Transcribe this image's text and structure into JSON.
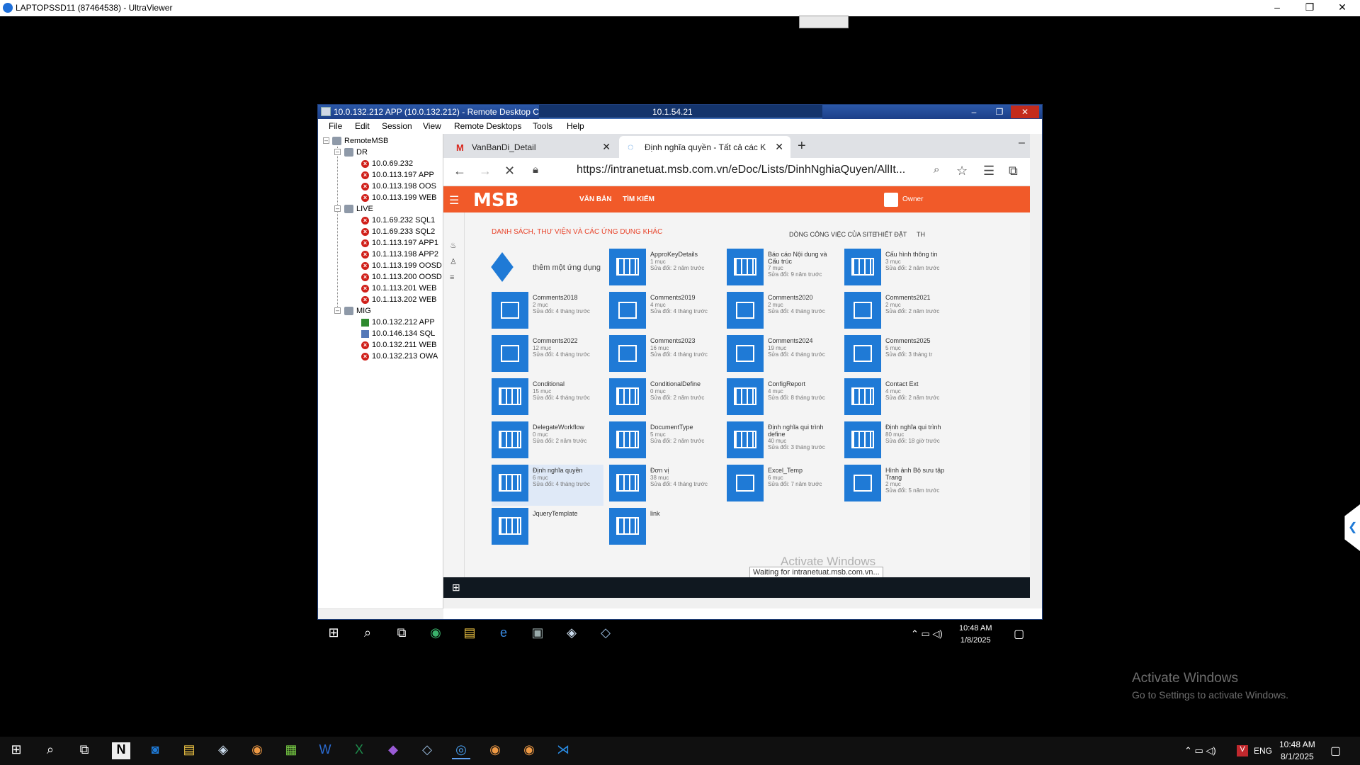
{
  "uv": {
    "title": "LAPTOPSSD11 (87464538) - UltraViewer",
    "minimize": "–",
    "restore": "❐",
    "close": "✕"
  },
  "rdc": {
    "title": "10.0.132.212 APP (10.0.132.212) - Remote Desktop C",
    "conn_ip": "10.1.54.21",
    "menu": [
      "File",
      "Edit",
      "Session",
      "View",
      "Remote Desktops",
      "Tools",
      "Help"
    ],
    "tree": {
      "root": "RemoteMSB",
      "groups": [
        {
          "name": "DR",
          "items": [
            "10.0.69.232",
            "10.0.113.197 APP",
            "10.0.113.198 OOS",
            "10.0.113.199 WEB"
          ]
        },
        {
          "name": "LIVE",
          "items": [
            "10.1.69.232 SQL1",
            "10.1.69.233 SQL2",
            "10.1.113.197 APP1",
            "10.1.113.198 APP2",
            "10.1.113.199 OOSD",
            "10.1.113.200 OOSD",
            "10.1.113.201 WEB",
            "10.1.113.202 WEB"
          ]
        },
        {
          "name": "MIG",
          "items": [
            "10.0.132.212 APP",
            "10.0.146.134 SQL",
            "10.0.132.211 WEB",
            "10.0.132.213 OWA"
          ]
        }
      ]
    }
  },
  "browser": {
    "tabs": [
      {
        "label": "VanBanDi_Detail"
      },
      {
        "label": "Định nghĩa quyền - Tất cả các K"
      }
    ],
    "url": "https://intranetuat.msb.com.vn/eDoc/Lists/DinhNghiaQuyen/AllIt...",
    "status": "Waiting for intranetuat.msb.com.vn..."
  },
  "msb": {
    "logo": "MSB",
    "nav": [
      "VĂN BẢN",
      "TÌM KIẾM"
    ],
    "owner": "Owner",
    "section_title": "DANH SÁCH, THƯ VIỆN VÀ CÁC ỨNG DỤNG KHÁC",
    "actions": [
      "DÒNG CÔNG VIỆC CỦA SITE",
      "THIẾT ĐẶT",
      "TH"
    ],
    "add_app": "thêm một ứng dụng",
    "apps": [
      {
        "name": "ApproKeyDetails",
        "count": "1 mục",
        "mod": "Sửa đổi: 2 năm trước",
        "type": "list"
      },
      {
        "name": "Báo cáo Nội dung và Cấu trúc",
        "count": "7 mục",
        "mod": "Sửa đổi: 9 năm trước",
        "type": "list"
      },
      {
        "name": "Cấu hình thông tin",
        "count": "3 mục",
        "mod": "Sửa đổi: 2 năm trước",
        "type": "list"
      },
      {
        "name": "Comments2018",
        "count": "2 mục",
        "mod": "Sửa đổi: 4 tháng trước",
        "type": "doc"
      },
      {
        "name": "Comments2019",
        "count": "4 mục",
        "mod": "Sửa đổi: 4 tháng trước",
        "type": "doc"
      },
      {
        "name": "Comments2020",
        "count": "2 mục",
        "mod": "Sửa đổi: 4 tháng trước",
        "type": "doc"
      },
      {
        "name": "Comments2021",
        "count": "2 mục",
        "mod": "Sửa đổi: 2 năm trước",
        "type": "doc"
      },
      {
        "name": "Comments2022",
        "count": "12 mục",
        "mod": "Sửa đổi: 4 tháng trước",
        "type": "doc"
      },
      {
        "name": "Comments2023",
        "count": "16 mục",
        "mod": "Sửa đổi: 4 tháng trước",
        "type": "doc"
      },
      {
        "name": "Comments2024",
        "count": "19 mục",
        "mod": "Sửa đổi: 4 tháng trước",
        "type": "doc"
      },
      {
        "name": "Comments2025",
        "count": "5 mục",
        "mod": "Sửa đổi: 3 tháng tr",
        "type": "doc"
      },
      {
        "name": "Conditional",
        "count": "15 mục",
        "mod": "Sửa đổi: 4 tháng trước",
        "type": "list"
      },
      {
        "name": "ConditionalDefine",
        "count": "0 mục",
        "mod": "Sửa đổi: 2 năm trước",
        "type": "list"
      },
      {
        "name": "ConfigReport",
        "count": "4 mục",
        "mod": "Sửa đổi: 8 tháng trước",
        "type": "list"
      },
      {
        "name": "Contact Ext",
        "count": "4 mục",
        "mod": "Sửa đổi: 2 năm trước",
        "type": "list"
      },
      {
        "name": "DelegateWorkflow",
        "count": "0 mục",
        "mod": "Sửa đổi: 2 năm trước",
        "type": "list"
      },
      {
        "name": "DocumentType",
        "count": "5 mục",
        "mod": "Sửa đổi: 2 năm trước",
        "type": "list"
      },
      {
        "name": "Định nghĩa qui trình define",
        "count": "40 mục",
        "mod": "Sửa đổi: 3 tháng trước",
        "type": "list"
      },
      {
        "name": "Định nghĩa qui trình",
        "count": "80 mục",
        "mod": "Sửa đổi: 18 giờ trước",
        "type": "list"
      },
      {
        "name": "Định nghĩa quyền",
        "count": "6 mục",
        "mod": "Sửa đổi: 4 tháng trước",
        "type": "list"
      },
      {
        "name": "Đơn vị",
        "count": "38 mục",
        "mod": "Sửa đổi: 4 tháng trước",
        "type": "list"
      },
      {
        "name": "Excel_Temp",
        "count": "6 mục",
        "mod": "Sửa đổi: 7 năm trước",
        "type": "doc"
      },
      {
        "name": "Hình ảnh Bộ sưu tập Trang",
        "count": "2 mục",
        "mod": "Sửa đổi: 5 năm trước",
        "type": "doc"
      },
      {
        "name": "JqueryTemplate",
        "count": "",
        "mod": "",
        "type": "list"
      },
      {
        "name": "link",
        "count": "",
        "mod": "",
        "type": "list"
      }
    ],
    "watermark": "Activate Windows",
    "watermark2": "Go to Settings to activate Windows."
  },
  "inner_clock": {
    "time": "10:48 AM",
    "date": "1/8/2025"
  },
  "outer": {
    "activate1": "Activate Windows",
    "activate2": "Go to Settings to activate Windows.",
    "lang": "ENG",
    "time": "10:48 AM",
    "date": "8/1/2025"
  }
}
